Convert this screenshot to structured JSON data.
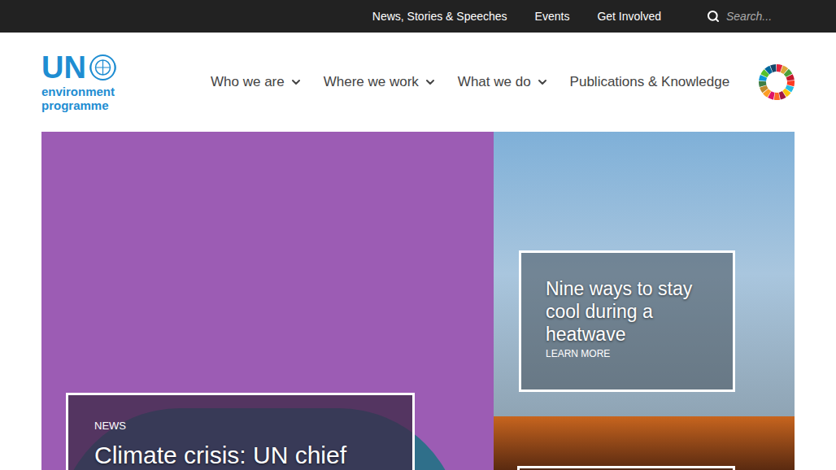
{
  "top_bar": {
    "links": [
      "News, Stories & Speeches",
      "Events",
      "Get Involved"
    ],
    "search": {
      "placeholder": "Search..."
    }
  },
  "logo": {
    "acronym": "UN",
    "name_line1": "environment",
    "name_line2": "programme"
  },
  "nav": {
    "items": [
      {
        "label": "Who we are",
        "has_dropdown": true
      },
      {
        "label": "Where we work",
        "has_dropdown": true
      },
      {
        "label": "What we do",
        "has_dropdown": true
      },
      {
        "label": "Publications & Knowledge",
        "has_dropdown": false
      }
    ]
  },
  "hero": {
    "main": {
      "tag": "NEWS",
      "title": "Climate crisis: UN chief"
    },
    "side": {
      "title": "Nine ways to stay cool during a heatwave",
      "link": "LEARN MORE"
    }
  }
}
